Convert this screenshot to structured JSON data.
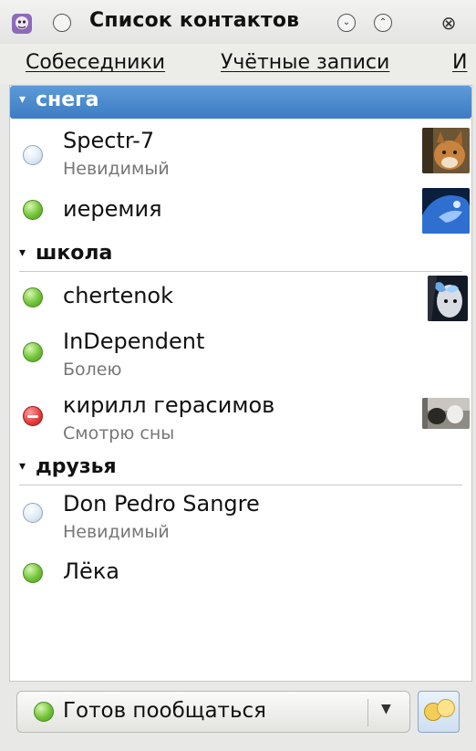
{
  "window": {
    "title": "Список контактов"
  },
  "menu": {
    "items": [
      {
        "underline": "С",
        "rest": "обеседники"
      },
      {
        "underline": "У",
        "rest": "чётные записи"
      },
      {
        "underline": "И",
        "rest": ""
      }
    ]
  },
  "groups": [
    {
      "name": "снега",
      "contacts": [
        {
          "name": "Spectr-7",
          "status_text": "Невидимый",
          "status": "invisible",
          "avatar": "lynx-photo"
        },
        {
          "name": "иеремия",
          "status_text": "",
          "status": "online",
          "avatar": "blue-face-art"
        }
      ]
    },
    {
      "name": "школа",
      "contacts": [
        {
          "name": "chertenok",
          "status_text": "",
          "status": "online",
          "avatar": "butterfly-face-art"
        },
        {
          "name": "InDependent",
          "status_text": "Болею",
          "status": "online",
          "avatar": ""
        },
        {
          "name": "кирилл герасимов",
          "status_text": "Смотрю сны",
          "status": "dnd",
          "avatar": "grey-photo"
        }
      ]
    },
    {
      "name": "друзья",
      "contacts": [
        {
          "name": "Don Pedro Sangre",
          "status_text": "Невидимый",
          "status": "invisible",
          "avatar": ""
        },
        {
          "name": "Лёка",
          "status_text": "",
          "status": "online",
          "avatar": ""
        }
      ]
    }
  ],
  "status_selector": {
    "label": "Готов пообщаться",
    "status": "online"
  },
  "colors": {
    "selection": "#4a8bd1",
    "online": "#72c33a",
    "dnd": "#e03a3a",
    "invisible": "#dde8f4"
  }
}
